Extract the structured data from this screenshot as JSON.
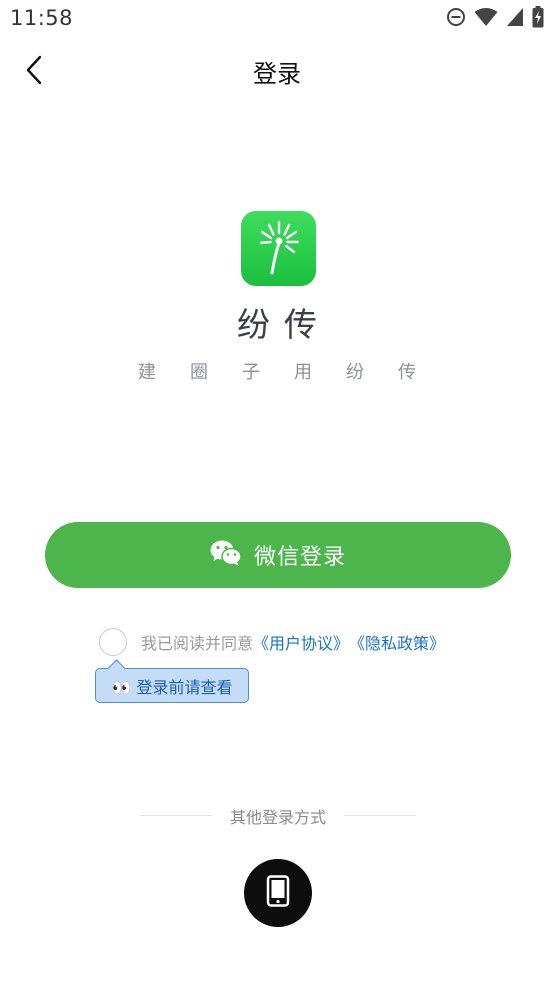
{
  "status_bar": {
    "time": "11:58"
  },
  "nav": {
    "title": "登录"
  },
  "app": {
    "name": "纷传",
    "slogan": "建圈子用纷传"
  },
  "wechat_login": {
    "label": "微信登录"
  },
  "agreement": {
    "prefix": "我已阅读并同意",
    "user_agreement": "《用户协议》",
    "privacy_policy": "《隐私政策》"
  },
  "tooltip": {
    "text": "👀 登录前请查看"
  },
  "other_login": {
    "label": "其他登录方式"
  },
  "icons": {
    "back": "chevron-left-icon",
    "wechat": "wechat-icon",
    "phone": "phone-icon",
    "dnd": "do-not-disturb-icon",
    "wifi": "wifi-icon",
    "signal": "signal-icon",
    "battery": "battery-charging-icon"
  },
  "colors": {
    "primary_green": "#4cb64c",
    "logo_green": "#1bbf3d",
    "link_blue": "#1a73c8",
    "tooltip_bg": "#c5dcf7"
  }
}
